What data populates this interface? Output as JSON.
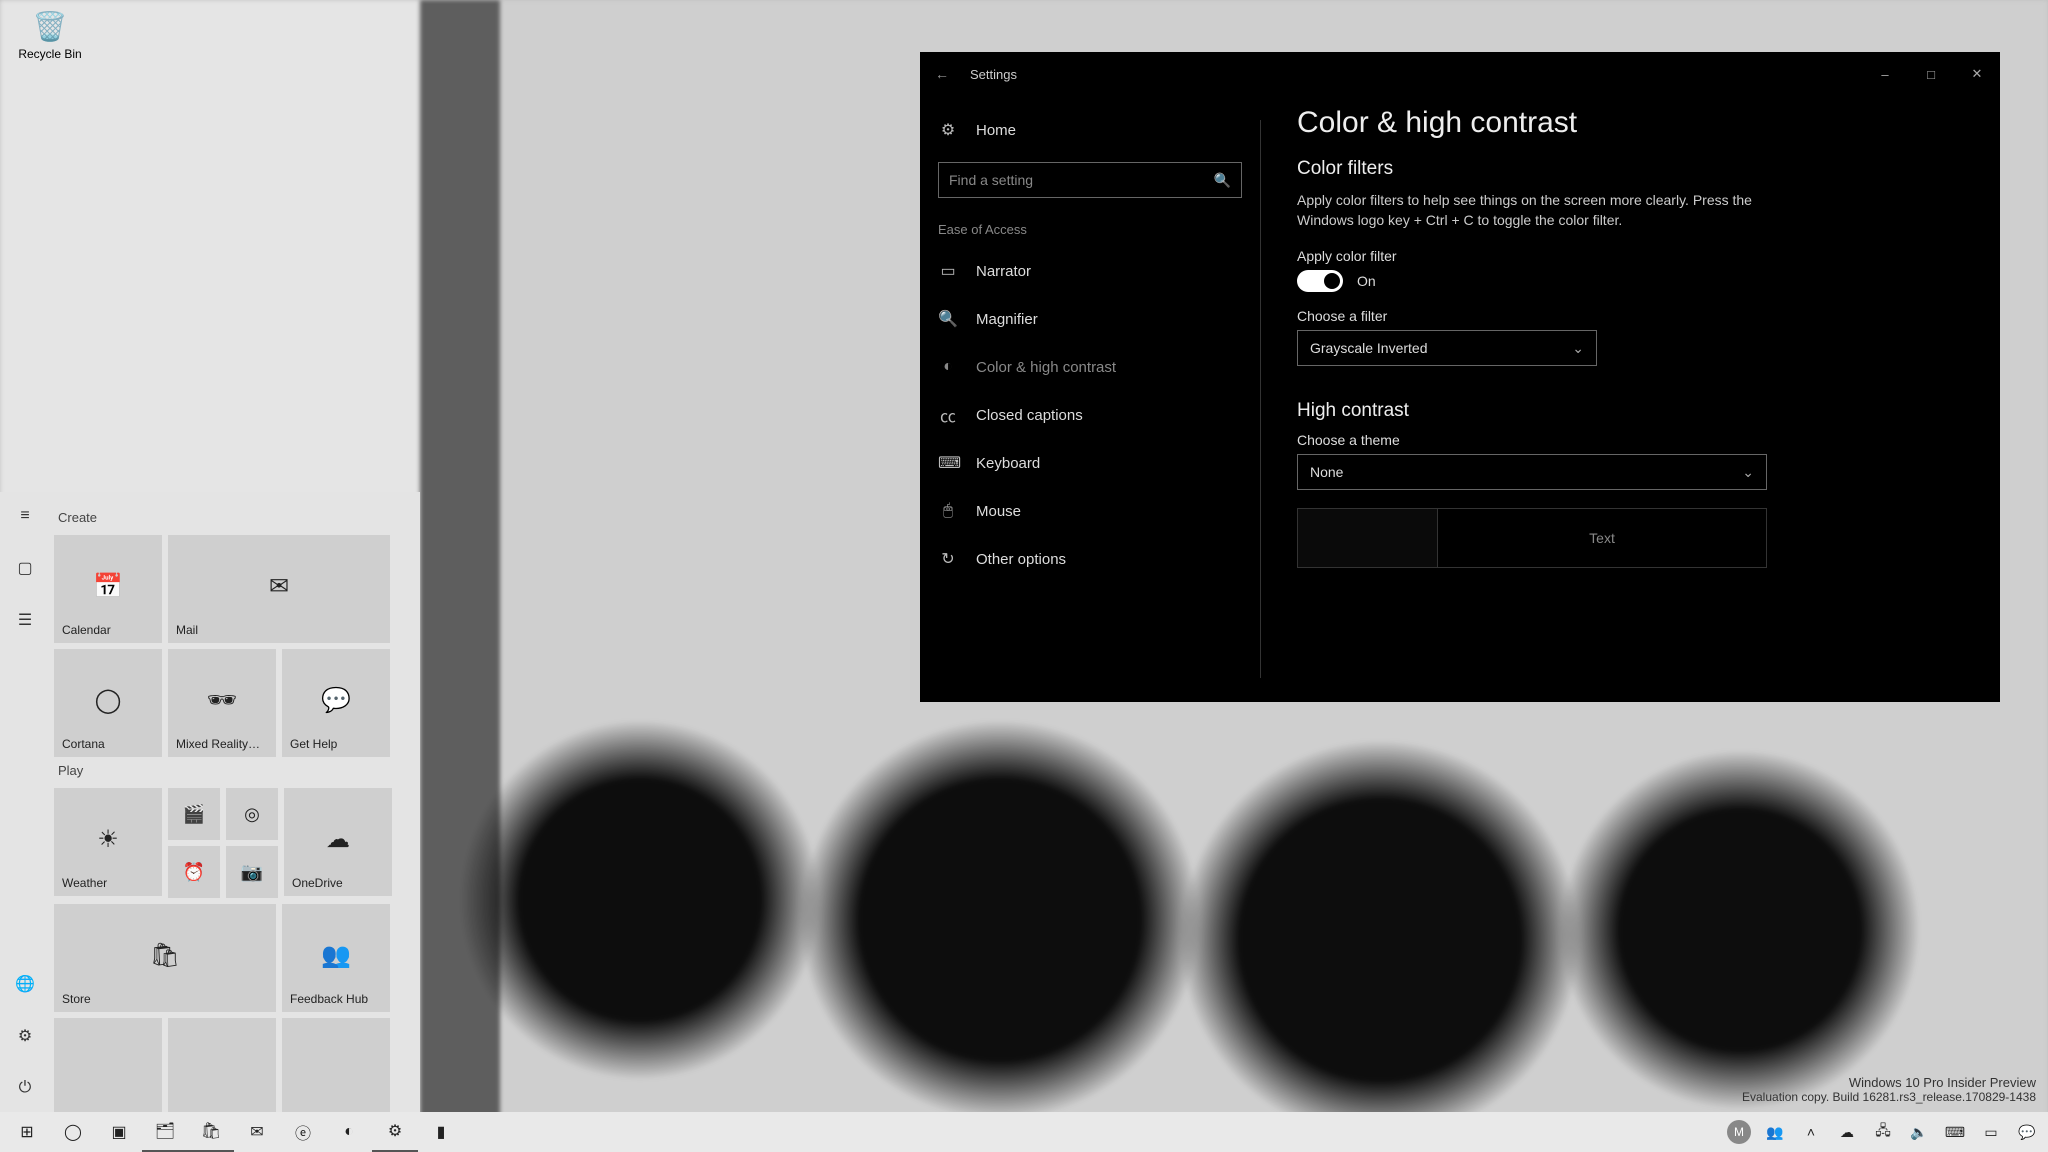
{
  "desktop": {
    "recycle_bin": "Recycle Bin"
  },
  "settings": {
    "title": "Settings",
    "home": "Home",
    "search_placeholder": "Find a setting",
    "group": "Ease of Access",
    "nav": {
      "narrator": "Narrator",
      "magnifier": "Magnifier",
      "colorhc": "Color & high contrast",
      "closedcaptions": "Closed captions",
      "keyboard": "Keyboard",
      "mouse": "Mouse",
      "other": "Other options"
    },
    "page": {
      "heading": "Color & high contrast",
      "section_filters": "Color filters",
      "filters_desc": "Apply color filters to help see things on the screen more clearly. Press the Windows logo key + Ctrl + C to toggle the color filter.",
      "apply_filter_label": "Apply color filter",
      "toggle_state": "On",
      "choose_filter_label": "Choose a filter",
      "filter_value": "Grayscale Inverted",
      "section_hc": "High contrast",
      "choose_theme_label": "Choose a theme",
      "theme_value": "None",
      "preview_text": "Text"
    }
  },
  "start": {
    "group_create": "Create",
    "group_play": "Play",
    "tiles": {
      "calendar": "Calendar",
      "mail": "Mail",
      "cortana": "Cortana",
      "mixedreality": "Mixed Reality…",
      "gethelp": "Get Help",
      "weather": "Weather",
      "onedrive": "OneDrive",
      "store": "Store",
      "feedbackhub": "Feedback Hub"
    }
  },
  "watermark": {
    "line1": "Windows 10 Pro Insider Preview",
    "line2": "Evaluation copy. Build 16281.rs3_release.170829-1438"
  },
  "tray": {
    "avatar_initial": "M"
  }
}
